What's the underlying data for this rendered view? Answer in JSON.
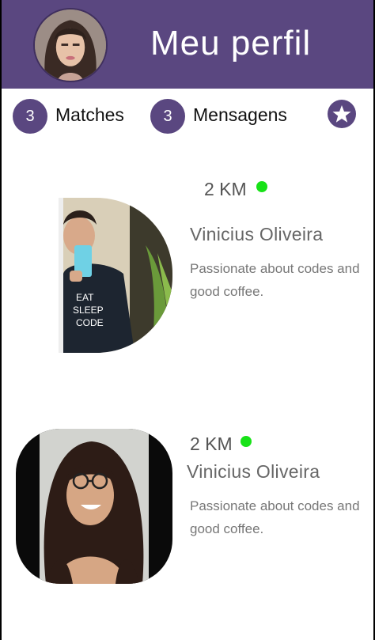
{
  "header": {
    "title": "Meu perfil"
  },
  "stats": {
    "matches_count": "3",
    "matches_label": "Matches",
    "messages_count": "3",
    "messages_label": "Mensagens"
  },
  "profiles": [
    {
      "distance": "2 KM",
      "name": "Vinicius Oliveira",
      "bio": "Passionate about codes and good coffee."
    },
    {
      "distance": "2 KM",
      "name": "Vinicius Oliveira",
      "bio": "Passionate about codes and good coffee."
    }
  ],
  "colors": {
    "primary": "#5a4780",
    "online": "#18e218",
    "background": "#ffffff"
  },
  "icons": {
    "favorites": "star-icon"
  }
}
